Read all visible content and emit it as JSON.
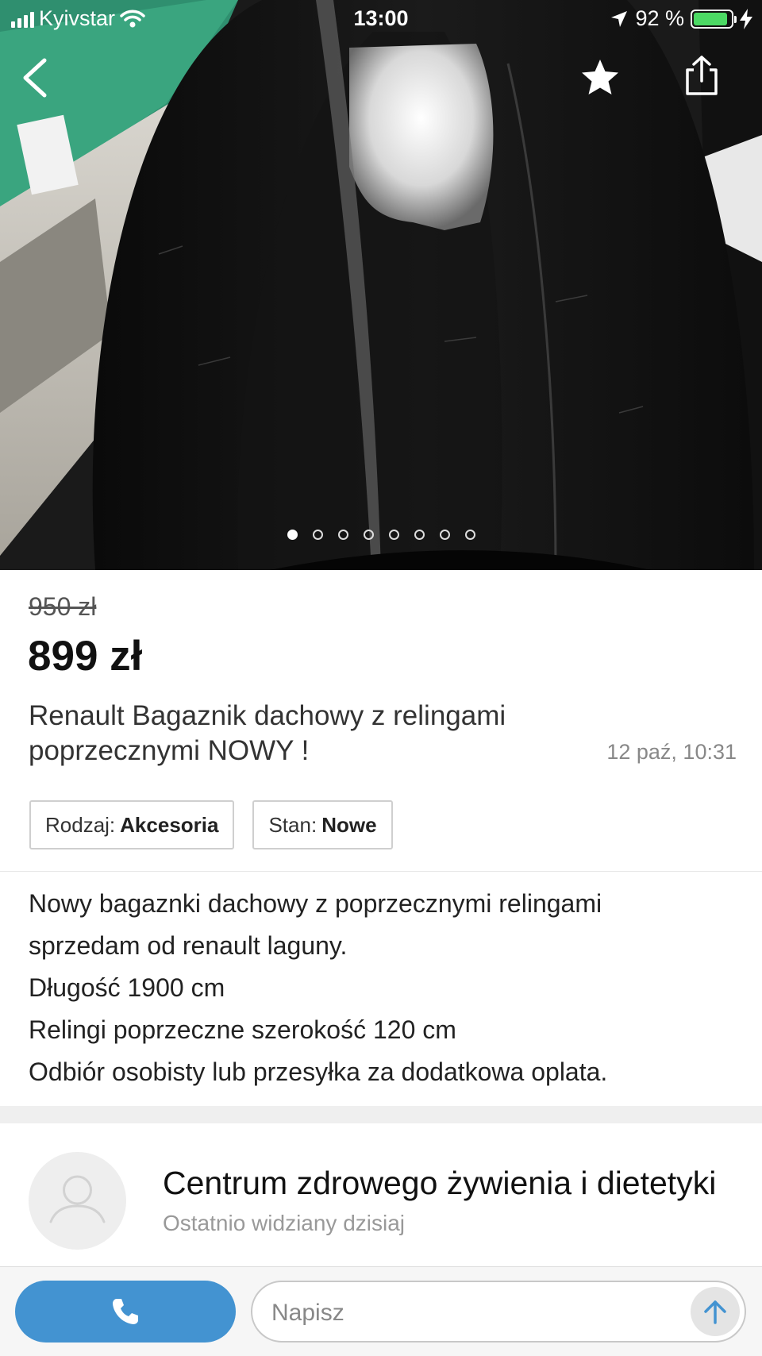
{
  "status_bar": {
    "carrier": "Kyivstar",
    "time": "13:00",
    "battery_percent_label": "92 %",
    "battery_level": 0.92,
    "battery_color": "#4cd964"
  },
  "nav": {
    "back_icon": "chevron-left-icon",
    "favorite_icon": "star-icon",
    "share_icon": "share-icon"
  },
  "gallery": {
    "total_images": 8,
    "current_index": 0
  },
  "listing": {
    "old_price": "950 zł",
    "price": "899 zł",
    "title": "Renault Bagaznik dachowy z relingami poprzecznymi NOWY !",
    "date": "12 paź, 10:31",
    "params": [
      {
        "label": "Rodzaj:",
        "value": "Akcesoria"
      },
      {
        "label": "Stan:",
        "value": "Nowe"
      }
    ],
    "description_lines": [
      "Nowy bagaznki dachowy z poprzecznymi relingami",
      "sprzedam od renault laguny.",
      "Długość 1900 cm",
      "Relingi poprzeczne szerokość 120 cm",
      "Odbiór osobisty lub przesyłka za dodatkowa oplata."
    ]
  },
  "seller": {
    "name": "Centrum zdrowego żywienia i dietetyki",
    "last_seen": "Ostatnio widziany dzisiaj"
  },
  "bottom_bar": {
    "call_icon": "phone-icon",
    "message_placeholder": "Napisz",
    "send_icon": "arrow-up-icon",
    "accent": "#4393d1"
  }
}
